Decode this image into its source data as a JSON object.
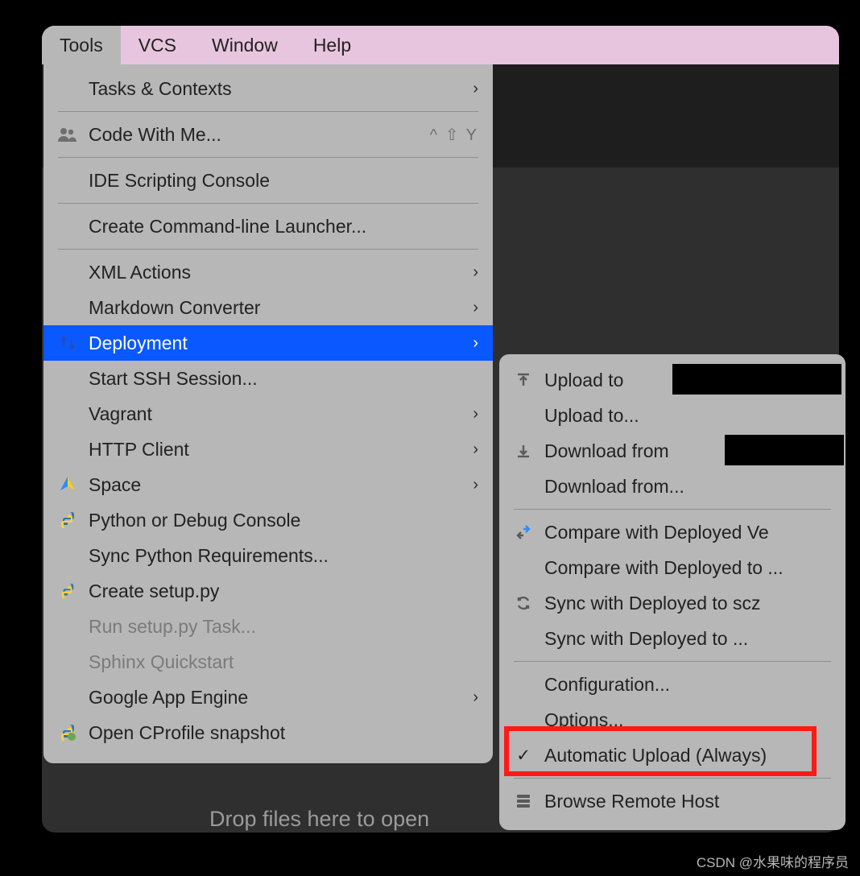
{
  "menubar": {
    "items": [
      "Tools",
      "VCS",
      "Window",
      "Help"
    ],
    "active_index": 0
  },
  "drop_hint": "Drop files here to open",
  "tools_menu": {
    "tasks": "Tasks & Contexts",
    "cwm": "Code With Me...",
    "cwm_shortcut": "^ ⇧ Y",
    "ide_scripting": "IDE Scripting Console",
    "create_cli": "Create Command-line Launcher...",
    "xml": "XML Actions",
    "markdown": "Markdown Converter",
    "deployment": "Deployment",
    "ssh": "Start SSH Session...",
    "vagrant": "Vagrant",
    "http": "HTTP Client",
    "space": "Space",
    "pydbg": "Python or Debug Console",
    "sync_req": "Sync Python Requirements...",
    "create_setup": "Create setup.py",
    "run_setup": "Run setup.py Task...",
    "sphinx": "Sphinx Quickstart",
    "gae": "Google App Engine",
    "cprofile": "Open CProfile snapshot"
  },
  "deployment_sub": {
    "upload_to_default": "Upload to",
    "upload_to": "Upload to...",
    "download_from_default": "Download from",
    "download_from": "Download from...",
    "compare_default": "Compare with Deployed Ve",
    "compare": "Compare with Deployed to ...",
    "sync_default": "Sync with Deployed to scz",
    "sync": "Sync with Deployed to ...",
    "configuration": "Configuration...",
    "options": "Options...",
    "auto_upload": "Automatic Upload (Always)",
    "browse": "Browse Remote Host"
  },
  "watermark": "CSDN @水果味的程序员"
}
